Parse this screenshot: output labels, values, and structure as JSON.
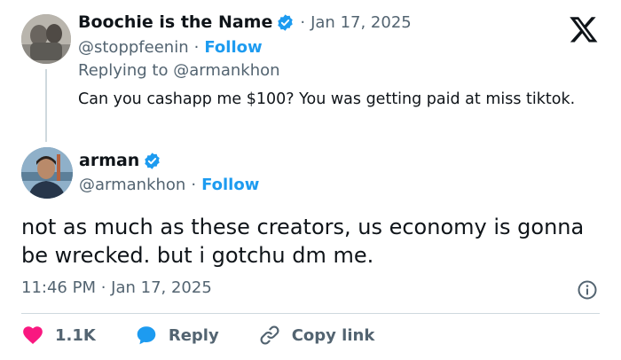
{
  "reply_tweet": {
    "author_name": "Boochie is the Name",
    "date": "Jan 17, 2025",
    "separator": "·",
    "handle": "@stoppfeenin",
    "follow_label": "Follow",
    "replying_to": "Replying to @armankhon",
    "text": "Can you cashapp me $100? You was getting paid at miss tiktok."
  },
  "main_tweet": {
    "author_name": "arman",
    "handle": "@armankhon",
    "separator": "·",
    "follow_label": "Follow",
    "text": "not as much as these creators, us economy is gonna be wrecked. but i gotchu dm me.",
    "timestamp": "11:46 PM · Jan 17, 2025"
  },
  "actions": {
    "likes": "1.1K",
    "reply_label": "Reply",
    "copy_link_label": "Copy link"
  },
  "icons": {
    "verified": "verified-badge-icon",
    "logo": "x-logo-icon",
    "info": "info-icon",
    "like": "heart-icon",
    "reply": "speech-bubble-icon",
    "copy": "link-icon"
  },
  "colors": {
    "accent_blue": "#1d9bf0",
    "like_pink": "#f91880",
    "muted_text": "#536471",
    "text": "#0f1419",
    "border": "#cfd9de"
  }
}
